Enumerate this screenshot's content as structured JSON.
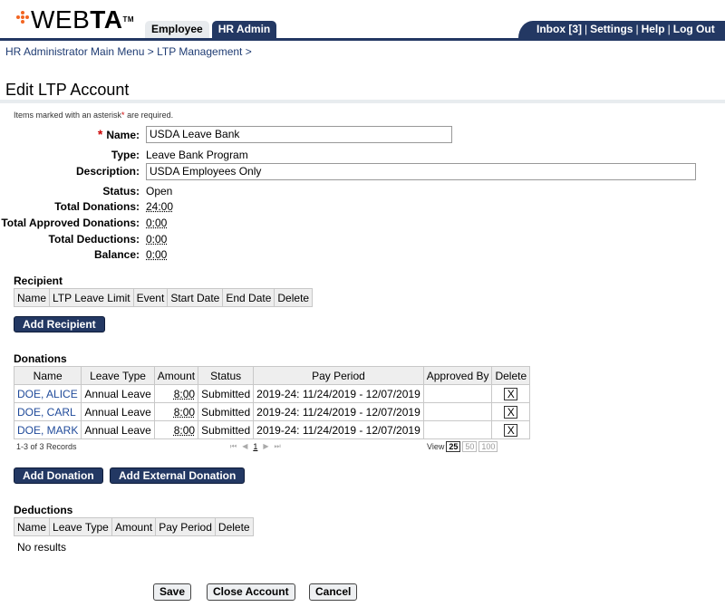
{
  "app": {
    "logo_thin": "WEB",
    "logo_bold": "TA",
    "logo_tm": "TM",
    "tabs": [
      {
        "label": "Employee",
        "active": false
      },
      {
        "label": "HR Admin",
        "active": true
      }
    ],
    "topnav": {
      "inbox": "Inbox [3]",
      "settings": "Settings",
      "help": "Help",
      "logout": "Log Out",
      "separator": "|"
    },
    "colors": {
      "brand_navy": "#233863",
      "logo_orange": "#f26522",
      "link_blue": "#1f4a9a"
    }
  },
  "breadcrumb": {
    "items": [
      "HR Administrator Main Menu",
      "LTP Management"
    ],
    "separator": ">",
    "text": "HR Administrator Main Menu > LTP Management >"
  },
  "page": {
    "title": "Edit LTP Account",
    "required_note_prefix": "Items marked with an asterisk",
    "required_note_ast": "*",
    "required_note_suffix": " are required."
  },
  "form": {
    "name": {
      "label": "Name:",
      "value": "USDA Leave Bank",
      "required": true
    },
    "type": {
      "label": "Type:",
      "value": "Leave Bank Program"
    },
    "description": {
      "label": "Description:",
      "value": "USDA Employees Only"
    },
    "status": {
      "label": "Status:",
      "value": "Open"
    },
    "total_donations": {
      "label": "Total Donations:",
      "value": "24:00"
    },
    "total_approved_donations": {
      "label": "Total Approved Donations:",
      "value": "0:00"
    },
    "total_deductions": {
      "label": "Total Deductions:",
      "value": "0:00"
    },
    "balance": {
      "label": "Balance:",
      "value": "0:00"
    }
  },
  "recipient": {
    "title": "Recipient",
    "columns": [
      "Name",
      "LTP Leave Limit",
      "Event",
      "Start Date",
      "End Date",
      "Delete"
    ],
    "add_button": "Add Recipient"
  },
  "donations": {
    "title": "Donations",
    "columns": [
      "Name",
      "Leave Type",
      "Amount",
      "Status",
      "Pay Period",
      "Approved By",
      "Delete"
    ],
    "rows": [
      {
        "name": "DOE, ALICE",
        "leave_type": "Annual Leave",
        "amount": "8:00",
        "status": "Submitted",
        "pay_period": "2019-24: 11/24/2019 - 12/07/2019",
        "approved_by": "",
        "delete": "X"
      },
      {
        "name": "DOE, CARL",
        "leave_type": "Annual Leave",
        "amount": "8:00",
        "status": "Submitted",
        "pay_period": "2019-24: 11/24/2019 - 12/07/2019",
        "approved_by": "",
        "delete": "X"
      },
      {
        "name": "DOE, MARK",
        "leave_type": "Annual Leave",
        "amount": "8:00",
        "status": "Submitted",
        "pay_period": "2019-24: 11/24/2019 - 12/07/2019",
        "approved_by": "",
        "delete": "X"
      }
    ],
    "records_text": "1-3 of 3 Records",
    "pager": {
      "first": "⏮",
      "prev": "◀",
      "current_page": "1",
      "next": "▶",
      "last": "⏭"
    },
    "view_label": "View",
    "view_options": [
      "25",
      "50",
      "100"
    ],
    "view_selected": "25",
    "add_button": "Add Donation",
    "add_external_button": "Add External Donation"
  },
  "deductions": {
    "title": "Deductions",
    "columns": [
      "Name",
      "Leave Type",
      "Amount",
      "Pay Period",
      "Delete"
    ],
    "empty_text": "No results"
  },
  "actions": {
    "save": "Save",
    "close_account": "Close Account",
    "cancel": "Cancel"
  }
}
